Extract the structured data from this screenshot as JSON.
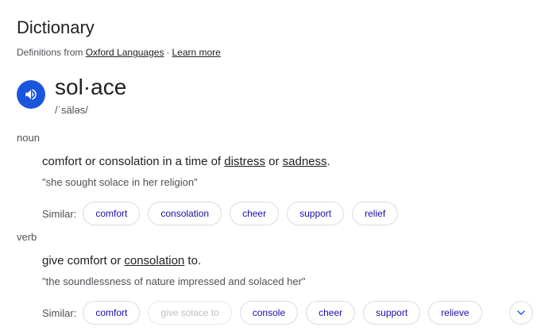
{
  "header": {
    "title": "Dictionary",
    "sources_prefix": "Definitions from",
    "source_link": "Oxford Languages",
    "separator": "·",
    "learn_more": "Learn more"
  },
  "entry": {
    "word": "sol·ace",
    "phonetic": "/ˈsäləs/"
  },
  "senses": [
    {
      "pos": "noun",
      "definition_parts": [
        "comfort or consolation in a time of ",
        "distress",
        " or ",
        "sadness",
        "."
      ],
      "example": "\"she sought solace in her religion\"",
      "similar_label": "Similar:",
      "chips": [
        "comfort",
        "consolation",
        "cheer",
        "support",
        "relief"
      ]
    },
    {
      "pos": "verb",
      "definition_parts": [
        "give comfort or ",
        "consolation",
        " to."
      ],
      "example": "\"the soundlessness of nature impressed and solaced her\"",
      "similar_label": "Similar:",
      "chips": [
        "comfort",
        "give solace to",
        "console",
        "cheer",
        "support",
        "relieve"
      ]
    }
  ],
  "icons": {
    "speaker": "volume-icon",
    "expand": "chevron-down-icon"
  },
  "colors": {
    "accent": "#1a56db",
    "link": "#1a0dab",
    "chip_border": "#dadce0",
    "muted_text": "#4d5156"
  }
}
